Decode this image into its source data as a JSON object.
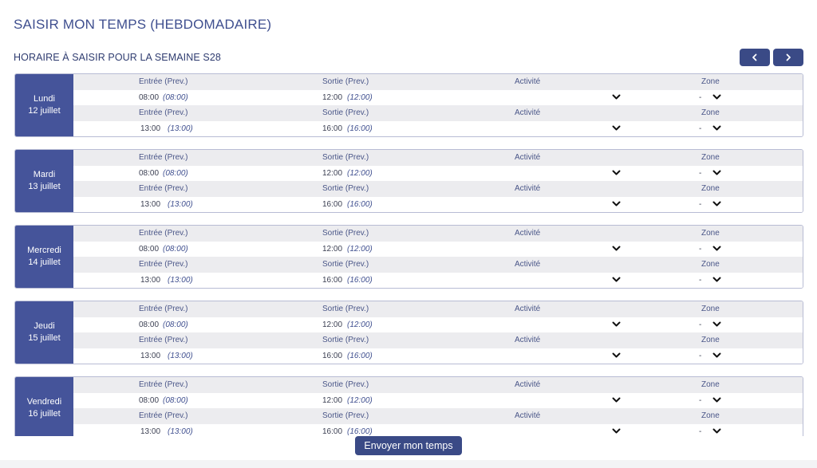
{
  "header": {
    "title": "SAISIR MON TEMPS (HEBDOMADAIRE)",
    "week_title": "HORAIRE À SAISIR POUR LA SEMAINE S28"
  },
  "columns": {
    "entry": "Entrée (Prev.)",
    "exit": "Sortie (Prev.)",
    "activity": "Activité",
    "zone": "Zone"
  },
  "days": [
    {
      "day": "Lundi",
      "date": "12 juillet",
      "shifts": [
        {
          "in": "08:00",
          "in_prev": "(08:00)",
          "out": "12:00",
          "out_prev": "(12:00)",
          "zone": "-"
        },
        {
          "in": "13:00",
          "in_prev": "(13:00)",
          "out": "16:00",
          "out_prev": "(16:00)",
          "zone": "-"
        }
      ]
    },
    {
      "day": "Mardi",
      "date": "13 juillet",
      "shifts": [
        {
          "in": "08:00",
          "in_prev": "(08:00)",
          "out": "12:00",
          "out_prev": "(12:00)",
          "zone": "-"
        },
        {
          "in": "13:00",
          "in_prev": "(13:00)",
          "out": "16:00",
          "out_prev": "(16:00)",
          "zone": "-"
        }
      ]
    },
    {
      "day": "Mercredi",
      "date": "14 juillet",
      "shifts": [
        {
          "in": "08:00",
          "in_prev": "(08:00)",
          "out": "12:00",
          "out_prev": "(12:00)",
          "zone": "-"
        },
        {
          "in": "13:00",
          "in_prev": "(13:00)",
          "out": "16:00",
          "out_prev": "(16:00)",
          "zone": "-"
        }
      ]
    },
    {
      "day": "Jeudi",
      "date": "15 juillet",
      "shifts": [
        {
          "in": "08:00",
          "in_prev": "(08:00)",
          "out": "12:00",
          "out_prev": "(12:00)",
          "zone": "-"
        },
        {
          "in": "13:00",
          "in_prev": "(13:00)",
          "out": "16:00",
          "out_prev": "(16:00)",
          "zone": "-"
        }
      ]
    },
    {
      "day": "Vendredi",
      "date": "16 juillet",
      "shifts": [
        {
          "in": "08:00",
          "in_prev": "(08:00)",
          "out": "12:00",
          "out_prev": "(12:00)",
          "zone": "-"
        },
        {
          "in": "13:00",
          "in_prev": "(13:00)",
          "out": "16:00",
          "out_prev": "(16:00)",
          "zone": "-"
        }
      ]
    }
  ],
  "actions": {
    "submit_label": "Envoyer mon temps"
  },
  "icons": {
    "prev": "chevron-left-icon",
    "next": "chevron-right-icon",
    "dropdown": "chevron-down-icon"
  },
  "colors": {
    "primary": "#3a4a86",
    "day_label_bg": "#45549a",
    "header_row_bg": "#ececef"
  }
}
